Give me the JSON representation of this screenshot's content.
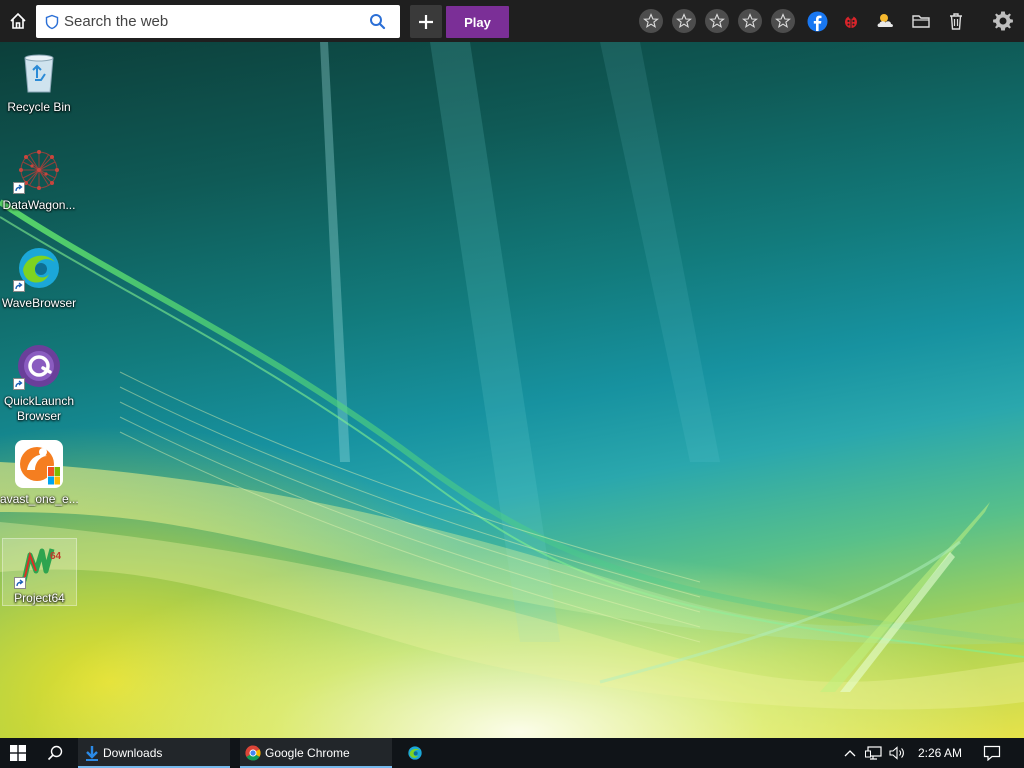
{
  "toolbar": {
    "search_placeholder": "Search the web",
    "play_label": "Play",
    "brand_color": "#7b2f97",
    "icons": [
      "home-icon",
      "shield-icon",
      "search-icon",
      "plus-icon",
      "star-icon",
      "star-icon",
      "star-icon",
      "star-icon",
      "star-icon",
      "facebook-icon",
      "ladybug-icon",
      "weather-icon",
      "folder-icon",
      "trash-icon",
      "gear-icon"
    ]
  },
  "desktop": {
    "icons": [
      {
        "label": "Recycle Bin",
        "icon": "recycle-bin-icon"
      },
      {
        "label": "DataWagon...",
        "icon": "datawagon-icon"
      },
      {
        "label": "WaveBrowser",
        "icon": "wavebrowser-icon"
      },
      {
        "label": "QuickLaunch Browser",
        "icon": "quicklaunch-icon"
      },
      {
        "label": "avast_one_e...",
        "icon": "avast-icon"
      },
      {
        "label": "Project64",
        "icon": "project64-icon"
      }
    ]
  },
  "taskbar": {
    "items": [
      {
        "label": "Downloads",
        "icon": "download-arrow-icon"
      },
      {
        "label": "Google Chrome",
        "icon": "chrome-icon"
      },
      {
        "label": "",
        "icon": "wavebrowser-icon"
      }
    ],
    "clock": "2:26 AM",
    "tray_icons": [
      "chevron-up-icon",
      "network-icon",
      "volume-icon",
      "notification-icon"
    ]
  }
}
